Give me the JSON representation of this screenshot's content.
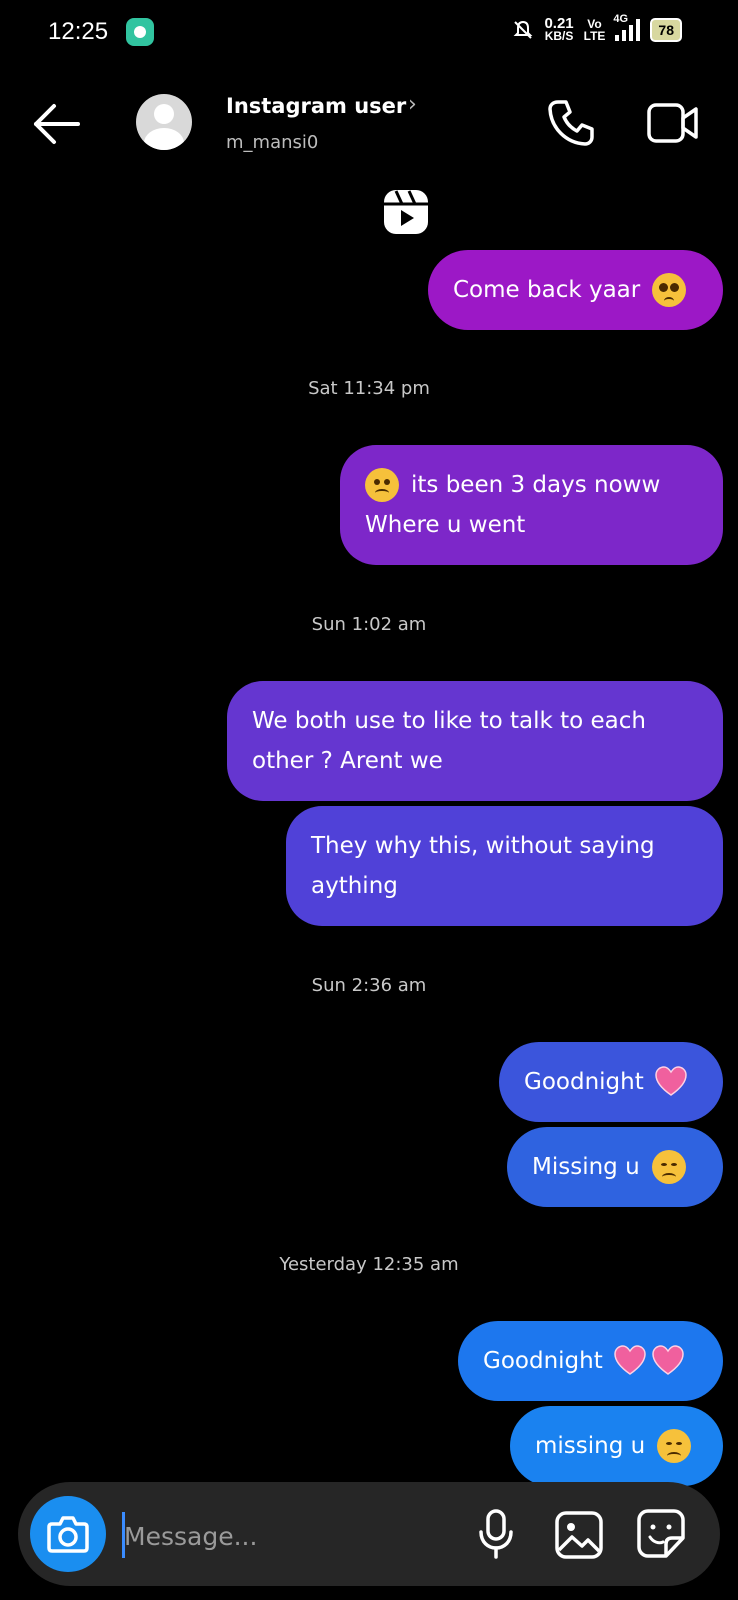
{
  "status_bar": {
    "time": "12:25",
    "speed_value": "0.21",
    "speed_unit": "KB/S",
    "volte_top": "Vo",
    "volte_bottom": "LTE",
    "network": "4G",
    "battery": "78"
  },
  "header": {
    "name": "Instagram user",
    "chevron": "›",
    "username": "m_mansi0"
  },
  "messages": [
    {
      "kind": "bubble",
      "text": "Come back yaar",
      "emoji": "pleading-face"
    },
    {
      "kind": "timestamp",
      "text": "Sat 11:34 pm"
    },
    {
      "kind": "bubble",
      "line1": "its been 3 days noww",
      "line2": "Where u went",
      "emoji": "frowning-face"
    },
    {
      "kind": "timestamp",
      "text": "Sun 1:02 am"
    },
    {
      "kind": "bubble",
      "line1": "We both use to like to talk to each",
      "line2": "other ? Arent we"
    },
    {
      "kind": "bubble",
      "line1": "They why this, without saying",
      "line2": "aything"
    },
    {
      "kind": "timestamp",
      "text": "Sun 2:36 am"
    },
    {
      "kind": "bubble",
      "text": "Goodnight",
      "emoji": "pink-heart"
    },
    {
      "kind": "bubble",
      "text": "Missing u",
      "emoji": "disappointed-face"
    },
    {
      "kind": "timestamp",
      "text": "Yesterday 12:35 am"
    },
    {
      "kind": "bubble",
      "text": "Goodnight",
      "emoji": "pink-heart x2"
    },
    {
      "kind": "bubble",
      "text": "missing u",
      "emoji": "disappointed-face"
    }
  ],
  "composer": {
    "placeholder": "Message..."
  },
  "icons": [
    "back-arrow-icon",
    "call-icon",
    "video-call-icon",
    "reels-icon",
    "camera-icon",
    "microphone-icon",
    "gallery-icon",
    "sticker-icon"
  ],
  "colors": {
    "background": "#000000",
    "bubble_gradient_top": "#9a18c8",
    "bubble_gradient_bottom": "#1d7df0",
    "composer": "#262626",
    "camera_button": "#1a8ef0"
  }
}
